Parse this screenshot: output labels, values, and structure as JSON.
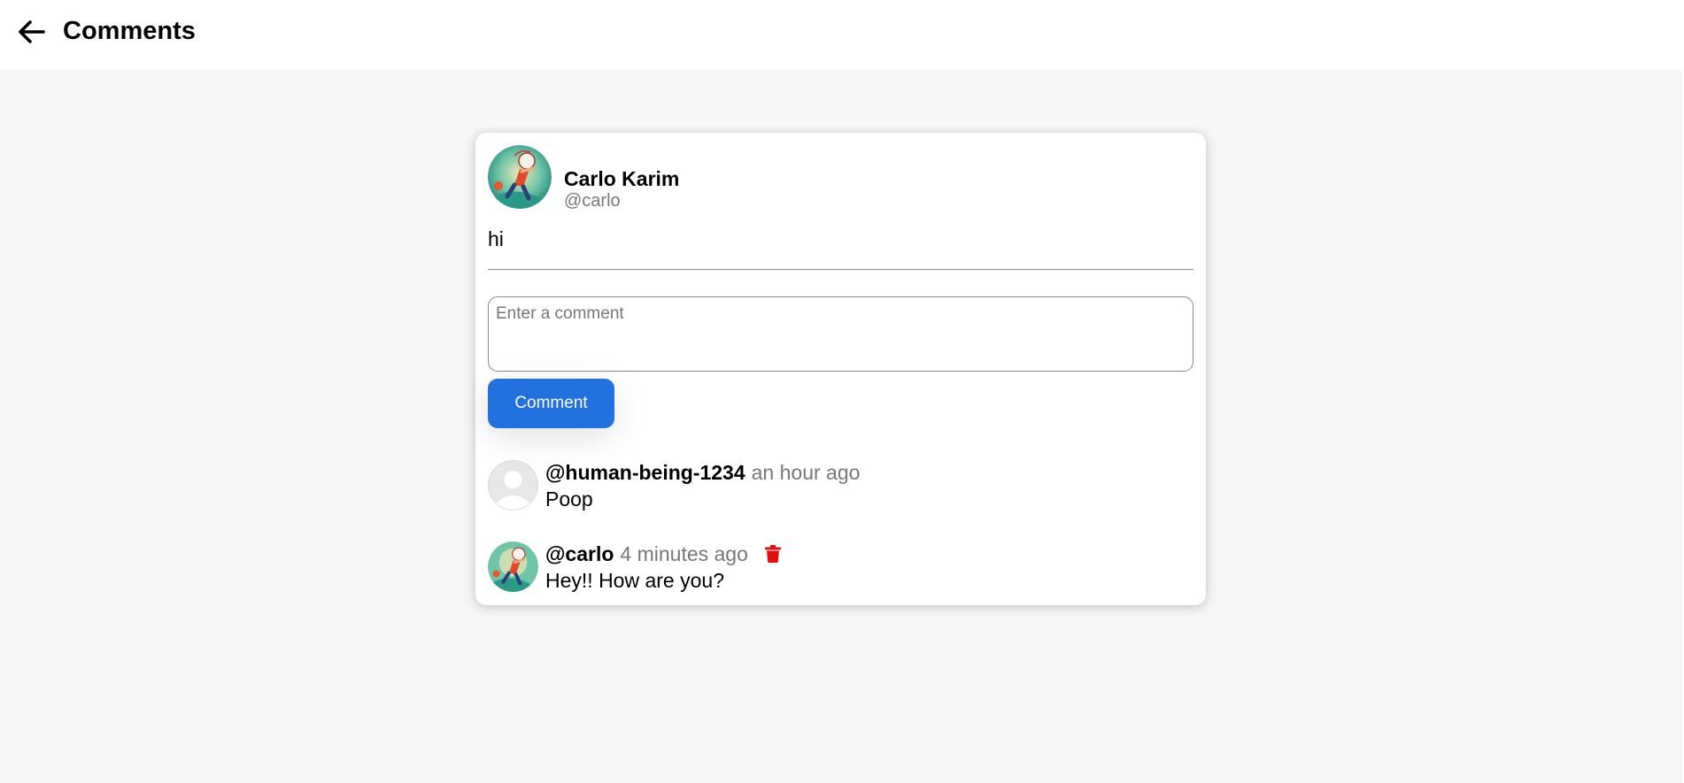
{
  "header": {
    "title": "Comments",
    "back_icon": "arrow-left-icon"
  },
  "post": {
    "author_name": "Carlo Karim",
    "author_handle": "@carlo",
    "body": "hi",
    "avatar": "illustrated-avatar"
  },
  "composer": {
    "placeholder": "Enter a comment",
    "value": "",
    "button_label": "Comment",
    "button_color": "#2370e0"
  },
  "comments": [
    {
      "handle": "@human-being-1234",
      "time": "an hour ago",
      "text": "Poop",
      "avatar": "default-user-avatar",
      "deletable": false
    },
    {
      "handle": "@carlo",
      "time": "4 minutes ago",
      "text": "Hey!! How are you?",
      "avatar": "illustrated-avatar",
      "deletable": true,
      "delete_icon": "trash-icon",
      "delete_color": "#e01010"
    }
  ]
}
